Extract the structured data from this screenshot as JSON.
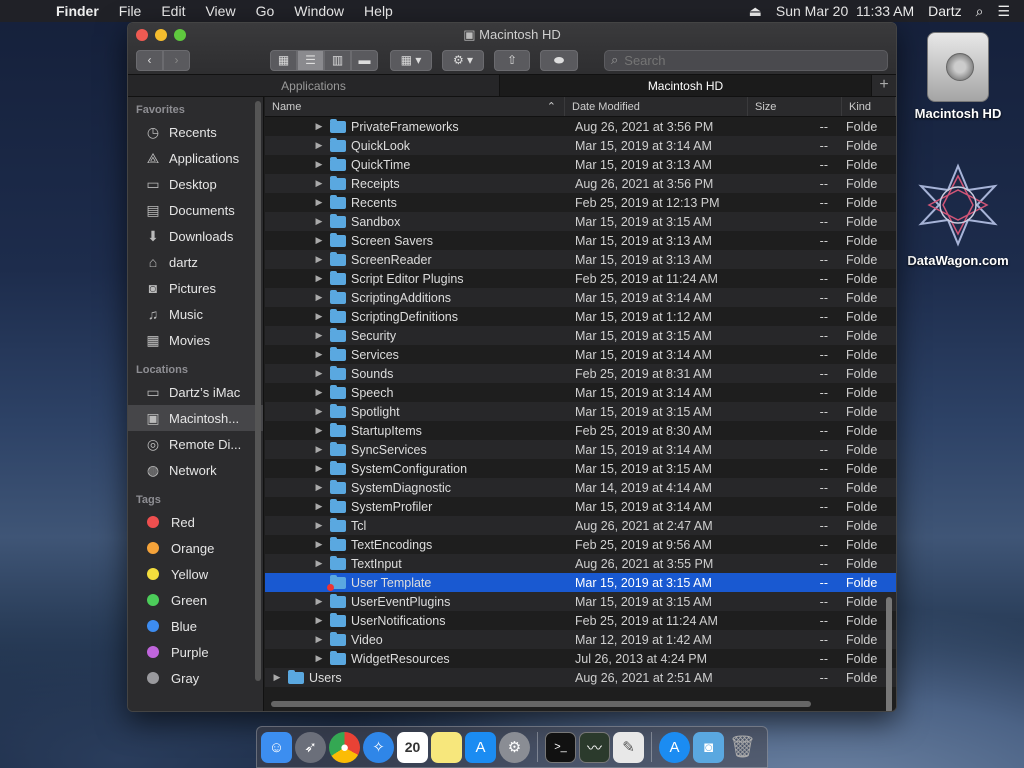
{
  "menubar": {
    "app": "Finder",
    "items": [
      "File",
      "Edit",
      "View",
      "Go",
      "Window",
      "Help"
    ],
    "clock": "Sun Mar 20  11:33 AM",
    "user": "Dartz"
  },
  "desktop": {
    "icons": [
      {
        "label": "Macintosh HD"
      },
      {
        "label": "DataWagon.com"
      }
    ]
  },
  "window": {
    "title": "Macintosh HD",
    "search_placeholder": "Search",
    "tabs": [
      "Applications",
      "Macintosh HD"
    ],
    "tab_add": "+"
  },
  "sidebar": {
    "favorites_header": "Favorites",
    "favorites": [
      {
        "label": "Recents",
        "icon": "clock-icon",
        "glyph": "◷"
      },
      {
        "label": "Applications",
        "icon": "applications-icon",
        "glyph": "⟁"
      },
      {
        "label": "Desktop",
        "icon": "desktop-icon",
        "glyph": "▭"
      },
      {
        "label": "Documents",
        "icon": "documents-icon",
        "glyph": "▤"
      },
      {
        "label": "Downloads",
        "icon": "downloads-icon",
        "glyph": "⬇"
      },
      {
        "label": "dartz",
        "icon": "home-icon",
        "glyph": "⌂"
      },
      {
        "label": "Pictures",
        "icon": "camera-icon",
        "glyph": "◙"
      },
      {
        "label": "Music",
        "icon": "music-icon",
        "glyph": "♫"
      },
      {
        "label": "Movies",
        "icon": "film-icon",
        "glyph": "▦"
      }
    ],
    "locations_header": "Locations",
    "locations": [
      {
        "label": "Dartz’s iMac",
        "icon": "imac-icon",
        "glyph": "▭"
      },
      {
        "label": "Macintosh...",
        "icon": "hard-drive-icon",
        "glyph": "▣"
      },
      {
        "label": "Remote Di...",
        "icon": "disc-icon",
        "glyph": "◎"
      },
      {
        "label": "Network",
        "icon": "network-icon",
        "glyph": "◍"
      }
    ],
    "tags_header": "Tags",
    "tags": [
      {
        "label": "Red",
        "color": "#ee4f4f"
      },
      {
        "label": "Orange",
        "color": "#f5a33a"
      },
      {
        "label": "Yellow",
        "color": "#f3dd3d"
      },
      {
        "label": "Green",
        "color": "#4ccd5a"
      },
      {
        "label": "Blue",
        "color": "#3d8cf0"
      },
      {
        "label": "Purple",
        "color": "#c065dc"
      },
      {
        "label": "Gray",
        "color": "#9a9a9e"
      }
    ]
  },
  "list": {
    "columns": {
      "name": "Name",
      "date": "Date Modified",
      "size": "Size",
      "kind": "Kind"
    },
    "rows": [
      {
        "name": "PrivateFrameworks",
        "date": "Aug 26, 2021 at 3:56 PM",
        "size": "--",
        "kind": "Folde",
        "level": 1
      },
      {
        "name": "QuickLook",
        "date": "Mar 15, 2019 at 3:14 AM",
        "size": "--",
        "kind": "Folde",
        "level": 1
      },
      {
        "name": "QuickTime",
        "date": "Mar 15, 2019 at 3:13 AM",
        "size": "--",
        "kind": "Folde",
        "level": 1
      },
      {
        "name": "Receipts",
        "date": "Aug 26, 2021 at 3:56 PM",
        "size": "--",
        "kind": "Folde",
        "level": 1
      },
      {
        "name": "Recents",
        "date": "Feb 25, 2019 at 12:13 PM",
        "size": "--",
        "kind": "Folde",
        "level": 1
      },
      {
        "name": "Sandbox",
        "date": "Mar 15, 2019 at 3:15 AM",
        "size": "--",
        "kind": "Folde",
        "level": 1
      },
      {
        "name": "Screen Savers",
        "date": "Mar 15, 2019 at 3:13 AM",
        "size": "--",
        "kind": "Folde",
        "level": 1
      },
      {
        "name": "ScreenReader",
        "date": "Mar 15, 2019 at 3:13 AM",
        "size": "--",
        "kind": "Folde",
        "level": 1
      },
      {
        "name": "Script Editor Plugins",
        "date": "Feb 25, 2019 at 11:24 AM",
        "size": "--",
        "kind": "Folde",
        "level": 1
      },
      {
        "name": "ScriptingAdditions",
        "date": "Mar 15, 2019 at 3:14 AM",
        "size": "--",
        "kind": "Folde",
        "level": 1
      },
      {
        "name": "ScriptingDefinitions",
        "date": "Mar 15, 2019 at 1:12 AM",
        "size": "--",
        "kind": "Folde",
        "level": 1
      },
      {
        "name": "Security",
        "date": "Mar 15, 2019 at 3:15 AM",
        "size": "--",
        "kind": "Folde",
        "level": 1
      },
      {
        "name": "Services",
        "date": "Mar 15, 2019 at 3:14 AM",
        "size": "--",
        "kind": "Folde",
        "level": 1
      },
      {
        "name": "Sounds",
        "date": "Feb 25, 2019 at 8:31 AM",
        "size": "--",
        "kind": "Folde",
        "level": 1
      },
      {
        "name": "Speech",
        "date": "Mar 15, 2019 at 3:14 AM",
        "size": "--",
        "kind": "Folde",
        "level": 1
      },
      {
        "name": "Spotlight",
        "date": "Mar 15, 2019 at 3:15 AM",
        "size": "--",
        "kind": "Folde",
        "level": 1
      },
      {
        "name": "StartupItems",
        "date": "Feb 25, 2019 at 8:30 AM",
        "size": "--",
        "kind": "Folde",
        "level": 1
      },
      {
        "name": "SyncServices",
        "date": "Mar 15, 2019 at 3:14 AM",
        "size": "--",
        "kind": "Folde",
        "level": 1
      },
      {
        "name": "SystemConfiguration",
        "date": "Mar 15, 2019 at 3:15 AM",
        "size": "--",
        "kind": "Folde",
        "level": 1
      },
      {
        "name": "SystemDiagnostic",
        "date": "Mar 14, 2019 at 4:14 AM",
        "size": "--",
        "kind": "Folde",
        "level": 1
      },
      {
        "name": "SystemProfiler",
        "date": "Mar 15, 2019 at 3:14 AM",
        "size": "--",
        "kind": "Folde",
        "level": 1
      },
      {
        "name": "Tcl",
        "date": "Aug 26, 2021 at 2:47 AM",
        "size": "--",
        "kind": "Folde",
        "level": 1
      },
      {
        "name": "TextEncodings",
        "date": "Feb 25, 2019 at 9:56 AM",
        "size": "--",
        "kind": "Folde",
        "level": 1
      },
      {
        "name": "TextInput",
        "date": "Aug 26, 2021 at 3:55 PM",
        "size": "--",
        "kind": "Folde",
        "level": 1
      },
      {
        "name": "User Template",
        "date": "Mar 15, 2019 at 3:15 AM",
        "size": "--",
        "kind": "Folde",
        "level": 1,
        "selected": true,
        "locked": true
      },
      {
        "name": "UserEventPlugins",
        "date": "Mar 15, 2019 at 3:15 AM",
        "size": "--",
        "kind": "Folde",
        "level": 1
      },
      {
        "name": "UserNotifications",
        "date": "Feb 25, 2019 at 11:24 AM",
        "size": "--",
        "kind": "Folde",
        "level": 1
      },
      {
        "name": "Video",
        "date": "Mar 12, 2019 at 1:42 AM",
        "size": "--",
        "kind": "Folde",
        "level": 1
      },
      {
        "name": "WidgetResources",
        "date": "Jul 26, 2013 at 4:24 PM",
        "size": "--",
        "kind": "Folde",
        "level": 1
      },
      {
        "name": "Users",
        "date": "Aug 26, 2021 at 2:51 AM",
        "size": "--",
        "kind": "Folde",
        "level": 0
      }
    ]
  }
}
